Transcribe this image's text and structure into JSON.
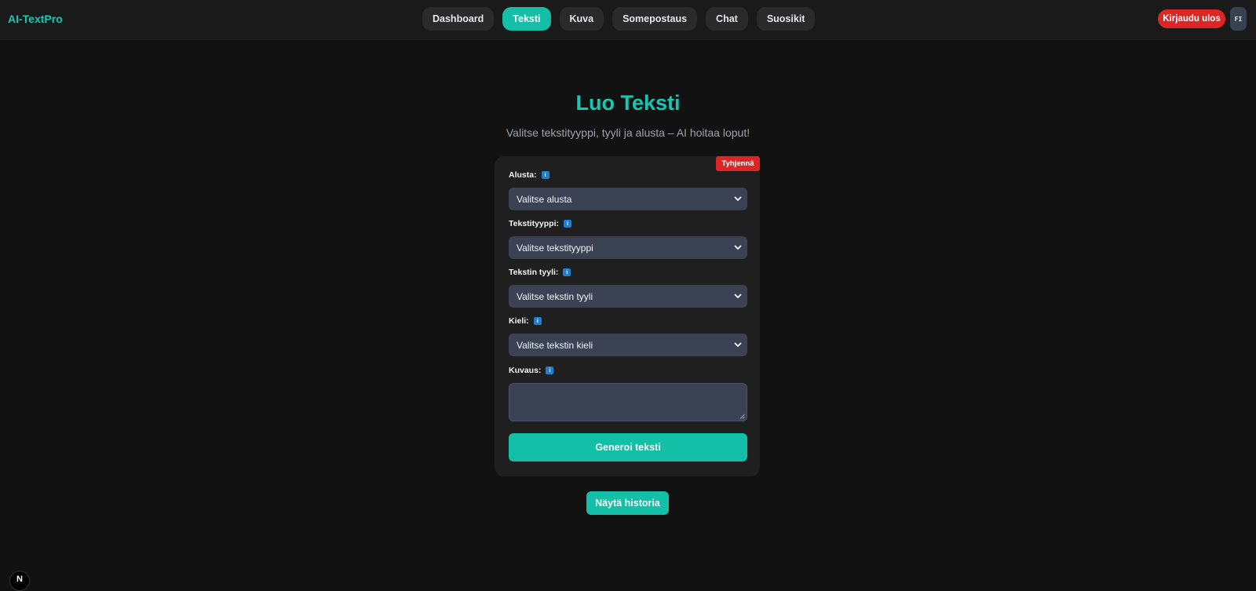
{
  "app": {
    "brand": "AI-TextPro"
  },
  "nav": {
    "items": [
      {
        "label": "Dashboard",
        "active": false
      },
      {
        "label": "Teksti",
        "active": true
      },
      {
        "label": "Kuva",
        "active": false
      },
      {
        "label": "Somepostaus",
        "active": false
      },
      {
        "label": "Chat",
        "active": false
      },
      {
        "label": "Suosikit",
        "active": false
      }
    ],
    "logout_label": "Kirjaudu ulos",
    "language_label": "FI"
  },
  "page": {
    "title": "Luo Teksti",
    "subtitle": "Valitse tekstityyppi, tyyli ja alusta – AI hoitaa loput!"
  },
  "form": {
    "clear_label": "Tyhjennä",
    "info_icon_glyph": "i",
    "fields": {
      "platform": {
        "label": "Alusta:",
        "value": "Valitse alusta"
      },
      "text_type": {
        "label": "Tekstityyppi:",
        "value": "Valitse tekstityyppi"
      },
      "text_style": {
        "label": "Tekstin tyyli:",
        "value": "Valitse tekstin tyyli"
      },
      "language": {
        "label": "Kieli:",
        "value": "Valitse tekstin kieli"
      },
      "description": {
        "label": "Kuvaus:",
        "value": ""
      }
    },
    "generate_label": "Generoi teksti"
  },
  "history_label": "Näytä historia",
  "corner_badge": "N",
  "colors": {
    "accent": "#13bfa6",
    "danger": "#dc2626",
    "background": "#121212",
    "card": "#1f1f1f",
    "input": "#3b4254",
    "info": "#1d7fd6"
  }
}
